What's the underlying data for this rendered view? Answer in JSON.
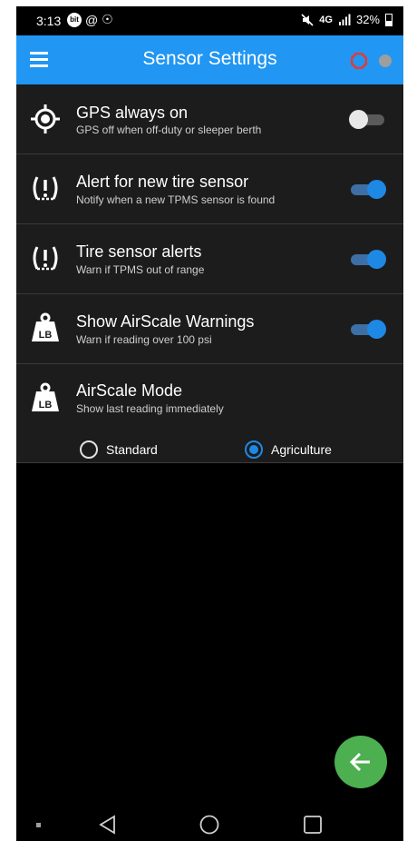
{
  "status_bar": {
    "time": "3:13",
    "battery": "32%",
    "icons": [
      "bitmoji-icon",
      "at-icon",
      "accessibility-icon",
      "mute-icon",
      "4g-icon",
      "signal-icon",
      "battery-icon"
    ]
  },
  "app_bar": {
    "title": "Sensor Settings",
    "menu_icon": "hamburger-menu-icon",
    "connection_icon": "red-octagon-ring-icon",
    "status_dot_color": "#9e9e9e"
  },
  "settings": [
    {
      "title": "GPS always on",
      "subtitle": "GPS off when off-duty or sleeper berth",
      "icon": "gps-target-icon",
      "toggle": "off"
    },
    {
      "title": "Alert for new tire sensor",
      "subtitle": "Notify when a new TPMS sensor is found",
      "icon": "tpms-alert-icon",
      "toggle": "on"
    },
    {
      "title": "Tire sensor alerts",
      "subtitle": "Warn if TPMS out of range",
      "icon": "tpms-alert-icon",
      "toggle": "on"
    },
    {
      "title": "Show AirScale Warnings",
      "subtitle": "Warn if reading over 100 psi",
      "icon": "lb-weight-icon",
      "toggle": "on"
    },
    {
      "title": "AirScale Mode",
      "subtitle": "Show last reading immediately",
      "icon": "lb-weight-icon"
    }
  ],
  "airscale_mode": {
    "options": [
      "Standard",
      "Agriculture"
    ],
    "selected": "Agriculture"
  },
  "lb_label": "LB",
  "fab_icon": "back-arrow-icon",
  "colors": {
    "accent": "#2196f3",
    "toggle_on": "#1e88e5",
    "fab": "#4caf50",
    "connection_ring": "#e53935"
  }
}
